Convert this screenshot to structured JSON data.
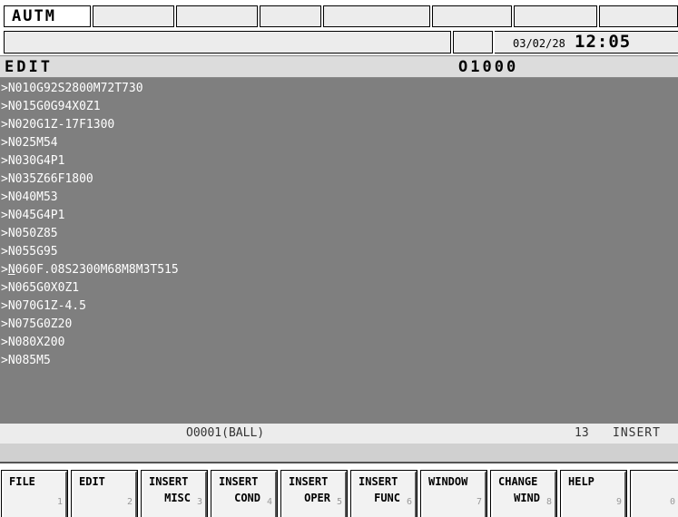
{
  "header": {
    "mode_tab": "AUTM",
    "date": "03/02/28",
    "time": "12:05"
  },
  "title_bar": {
    "mode": "EDIT",
    "program_number": "O1000"
  },
  "program": {
    "lines": [
      {
        "prefix": ">",
        "text": "N010G92S2800M72T730"
      },
      {
        "prefix": ">",
        "text": "N015G0G94X0Z1"
      },
      {
        "prefix": ">",
        "text": "N020G1Z-17F1300"
      },
      {
        "prefix": ">",
        "text": "N025M54"
      },
      {
        "prefix": ">",
        "text": "N030G4P1"
      },
      {
        "prefix": ">",
        "text": "N035Z66F1800"
      },
      {
        "prefix": ">",
        "text": "N040M53"
      },
      {
        "prefix": ">",
        "text": "N045G4P1"
      },
      {
        "prefix": ">",
        "text": "N050Z85"
      },
      {
        "prefix": ">",
        "text": "N055G95"
      },
      {
        "prefix": ">",
        "text": "N060F.08S2300M68M8M3T515",
        "cursor_char": "N",
        "rest": "060F.08S2300M68M8M3T515"
      },
      {
        "prefix": ">",
        "text": "N065G0X0Z1"
      },
      {
        "prefix": ">",
        "text": "N070G1Z-4.5"
      },
      {
        "prefix": ">",
        "text": "N075G0Z20"
      },
      {
        "prefix": ">",
        "text": "N080X200"
      },
      {
        "prefix": ">",
        "text": "N085M5"
      }
    ]
  },
  "status": {
    "program_name": "O0001(BALL)",
    "line_count": "13",
    "edit_mode": "INSERT"
  },
  "softkeys": [
    {
      "line1": "FILE",
      "line2": "",
      "number": "1"
    },
    {
      "line1": "EDIT",
      "line2": "",
      "number": "2"
    },
    {
      "line1": "INSERT",
      "line2": "MISC",
      "number": "3"
    },
    {
      "line1": "INSERT",
      "line2": "COND",
      "number": "4"
    },
    {
      "line1": "INSERT",
      "line2": "OPER",
      "number": "5"
    },
    {
      "line1": "INSERT",
      "line2": "FUNC",
      "number": "6"
    },
    {
      "line1": "WINDOW",
      "line2": "",
      "number": "7"
    },
    {
      "line1": "CHANGE",
      "line2": "WIND",
      "number": "8"
    },
    {
      "line1": "HELP",
      "line2": "",
      "number": "9"
    },
    {
      "line1": "",
      "line2": "",
      "number": "0"
    }
  ],
  "colors": {
    "program_background": "#7f7f7f",
    "program_text": "#ffffff",
    "panel_gray": "#ececec"
  }
}
